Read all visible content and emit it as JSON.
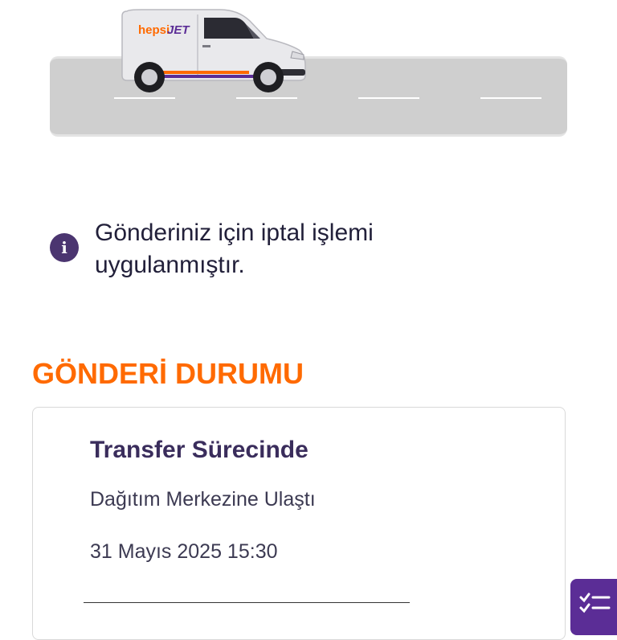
{
  "hero": {
    "brand_part1": "hepsi",
    "brand_part2": "JET",
    "brand_color_primary": "#ff6a00",
    "brand_color_secondary": "#5b2d96"
  },
  "notice": {
    "icon": "info-icon",
    "text": "Gönderiniz için iptal işlemi uygulanmıştır."
  },
  "section": {
    "title": "GÖNDERİ DURUMU"
  },
  "status": {
    "title": "Transfer Sürecinde",
    "subtitle": "Dağıtım Merkezine Ulaştı",
    "date": "31 Mayıs 2025 15:30"
  },
  "fab": {
    "icon": "checklist-icon"
  },
  "colors": {
    "accent": "#ff6a00",
    "purple": "#4b3570"
  }
}
